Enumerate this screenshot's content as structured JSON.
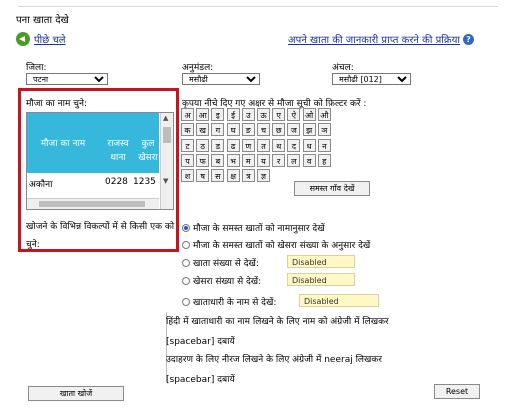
{
  "header": {
    "title": "पना खाता देखे"
  },
  "nav": {
    "back_label": "पीछे चले",
    "help_link": "अपने खाता की जानकारी प्राप्त करने की प्रक्रिया",
    "help_icon": "help-icon"
  },
  "filters": {
    "district": {
      "label": "जिला:",
      "value": "पटना"
    },
    "subdivision": {
      "label": "अनुमंडल:",
      "value": "मसौढी"
    },
    "circle": {
      "label": "अंचल:",
      "value": "मसौढी [012]"
    }
  },
  "village_select": {
    "label": "मौजा का नाम चुने:",
    "columns": [
      "मौजा का नाम",
      "राजस्व थाना",
      "कुल खेसरा"
    ],
    "rows": [
      {
        "name": "अकौना",
        "thana": "0228",
        "khesra": "1235"
      }
    ]
  },
  "filter_hint": "कृपया नीचे दिए गए अक्षर से मौजा सूची को फ़िल्टर करें :",
  "letters": [
    [
      "अ",
      "आ",
      "इ",
      "ई",
      "उ",
      "ऊ",
      "ए",
      "ऐ",
      "ओ",
      "औ"
    ],
    [
      "क",
      "ख",
      "ग",
      "घ",
      "ङ",
      "च",
      "छ",
      "ज",
      "झ",
      "ञ"
    ],
    [
      "ट",
      "ठ",
      "ड",
      "ढ",
      "ण",
      "त",
      "थ",
      "द",
      "ध",
      "न"
    ],
    [
      "प",
      "फ",
      "ब",
      "भ",
      "म",
      "य",
      "र",
      "ल",
      "व",
      "ह"
    ],
    [
      "श",
      "ष",
      "स",
      "क्ष",
      "त्र",
      "ज्ञ"
    ]
  ],
  "all_villages_button": "समस्त गाँव देखें",
  "options_label": "खोजने के विभिन्न विकल्पों में से किसी एक को चुने:",
  "options": [
    {
      "label": "मौजा के समस्त खातों को नामानुसार देखें",
      "selected": true
    },
    {
      "label": "मौजा के समस्त खातों को खेसरा संख्या के अनुसार देखें",
      "selected": false
    },
    {
      "label": "खाता संख्या से देखें:",
      "selected": false,
      "input": "Disabled"
    },
    {
      "label": "खेसरा संख्या से देखें:",
      "selected": false,
      "input": "Disabled"
    },
    {
      "label": "खाताधारी के नाम से देखें:",
      "selected": false,
      "input": "Disabled"
    }
  ],
  "help_text": [
    "हिंदी में खाताधारी का नाम लिखने के लिए नाम को अंग्रेजी में लिखकर",
    "[spacebar] दबायें",
    "उदाहरण के लिए नीरज लिखने के लिए अंग्रेजी में neeraj लिखकर",
    "[spacebar] दबायें"
  ],
  "buttons": {
    "search": "खाता खोजें",
    "reset": "Reset"
  },
  "colors": {
    "highlight": "#c8141e",
    "list_header": "#35b8dc",
    "link": "#1a3399",
    "disabled_bg": "#fff8c4"
  }
}
